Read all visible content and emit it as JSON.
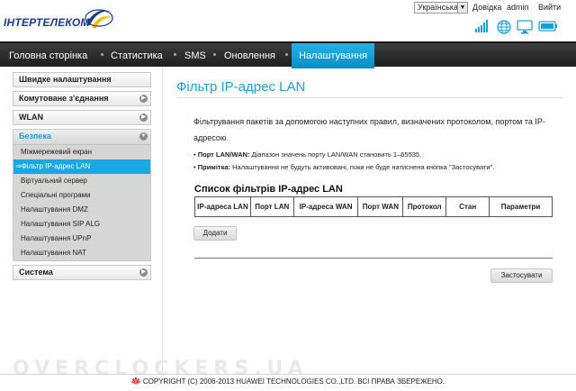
{
  "header": {
    "logo_text": "ІНТЕРТЕЛЕКОМ",
    "language": "Українська",
    "help_label": "Довідка",
    "user_label": "admin",
    "logout_label": "Вийти"
  },
  "nav": {
    "items": [
      {
        "label": "Головна сторінка"
      },
      {
        "label": "Статистика"
      },
      {
        "label": "SMS"
      },
      {
        "label": "Оновлення"
      },
      {
        "label": "Налаштування"
      }
    ],
    "active": "Налаштування"
  },
  "sidebar": {
    "quick_setup": "Швидке налаштування",
    "dialup": "Комутоване з'єднання",
    "wlan": "WLAN",
    "security": "Безпека",
    "security_items": [
      "Міжмережевий екран",
      "⇒Фільтр IP-адрес LAN",
      "Віртуальний сервер",
      "Спеціальні програми",
      "Налаштування DMZ",
      "Налаштування SIP ALG",
      "Налаштування UPnP",
      "Налаштування NAT"
    ],
    "system": "Система"
  },
  "main": {
    "title": "Фільтр IP-адрес LAN",
    "description": "Фільтрування пакетів за допомогою наступних правил, визначених протоколом, портом та IP-адресою.",
    "note1_label": "Порт LAN/WAN:",
    "note1_text": "Діапазон значень порту LAN/WAN становить 1–65535.",
    "note2_label": "Примітка:",
    "note2_text": "Налаштування не будуть активовані, поки не буде натиснена кнопка \"Застосувати\".",
    "list_title": "Список фільтрів IP-адрес LAN",
    "columns": [
      "IP-адреса LAN",
      "Порт LAN",
      "IP-адреса WAN",
      "Порт WAN",
      "Протокол",
      "Стан",
      "Параметри"
    ],
    "add_label": "Додати",
    "apply_label": "Застосувати"
  },
  "footer": {
    "watermark": "OVERCLOCKERS.UA",
    "copyright": "COPYRIGHT (C) 2006-2013 HUAWEI TECHNOLOGIES CO.,LTD. ВСІ ПРАВА ЗБЕРЕЖЕНО."
  },
  "colors": {
    "accent": "#1aa0d8",
    "nav_bg": "#2b2b2b",
    "logo_blue": "#1a3a8a",
    "logo_yellow": "#f2c200"
  },
  "icons": [
    "signal-icon",
    "globe-icon",
    "monitor-icon",
    "battery-icon",
    "huawei-logo-icon"
  ]
}
